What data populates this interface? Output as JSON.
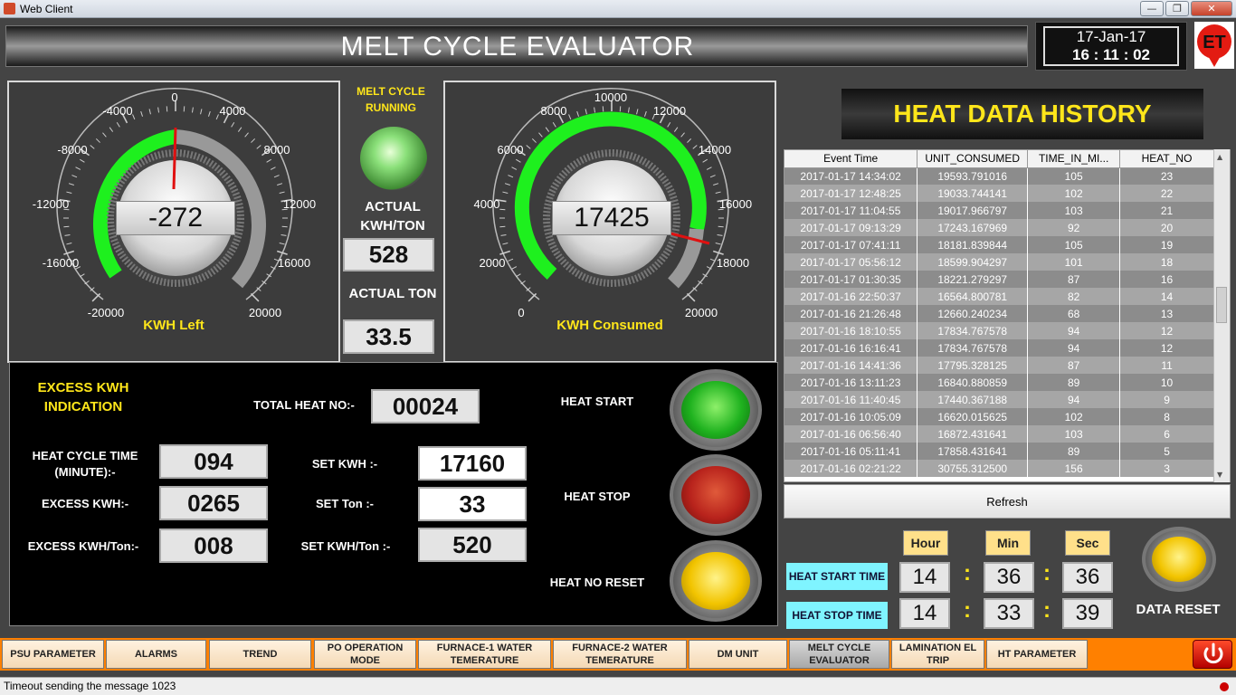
{
  "window": {
    "title": "Web Client",
    "min": "—",
    "max": "❐",
    "close": "✕"
  },
  "header": {
    "title": "MELT CYCLE EVALUATOR",
    "date": "17-Jan-17",
    "time": "16 : 11 : 02",
    "logo_text": "ET"
  },
  "gauge_left": {
    "label": "KWH Left",
    "value": "-272",
    "ticks": [
      "-20000",
      "-16000",
      "-12000",
      "-8000",
      "-4000",
      "0",
      "4000",
      "8000",
      "12000",
      "16000",
      "20000"
    ]
  },
  "gauge_right": {
    "label": "KWH Consumed",
    "value": "17425",
    "ticks": [
      "0",
      "2000",
      "4000",
      "6000",
      "8000",
      "10000",
      "12000",
      "14000",
      "16000",
      "18000",
      "20000"
    ]
  },
  "status": {
    "running_label": "MELT CYCLE RUNNING",
    "actual_kwh_ton_label": "ACTUAL KWH/TON",
    "actual_kwh_ton": "528",
    "actual_ton_label": "ACTUAL TON",
    "actual_ton": "33.5"
  },
  "lower": {
    "excess_indication": "EXCESS KWH INDICATION",
    "total_heat_label": "TOTAL HEAT NO:-",
    "total_heat": "00024",
    "heat_cycle_label": "HEAT CYCLE TIME (MINUTE):-",
    "heat_cycle": "094",
    "excess_kwh_label": "EXCESS KWH:-",
    "excess_kwh": "0265",
    "excess_kwh_ton_label": "EXCESS KWH/Ton:-",
    "excess_kwh_ton": "008",
    "set_kwh_label": "SET KWH :-",
    "set_kwh": "17160",
    "set_ton_label": "SET Ton :-",
    "set_ton": "33",
    "set_kwh_ton_label": "SET KWH/Ton :-",
    "set_kwh_ton": "520",
    "heat_start": "HEAT START",
    "heat_stop": "HEAT STOP",
    "heat_no_reset": "HEAT NO RESET",
    "colors": {
      "start": "#1fb21f",
      "stop": "#b8231c",
      "reset": "#f2c400"
    }
  },
  "history": {
    "title": "HEAT DATA HISTORY",
    "columns": [
      "Event Time",
      "UNIT_CONSUMED",
      "TIME_IN_MI...",
      "HEAT_NO"
    ],
    "rows": [
      [
        "2017-01-17 14:34:02",
        "19593.791016",
        "105",
        "23"
      ],
      [
        "2017-01-17 12:48:25",
        "19033.744141",
        "102",
        "22"
      ],
      [
        "2017-01-17 11:04:55",
        "19017.966797",
        "103",
        "21"
      ],
      [
        "2017-01-17 09:13:29",
        "17243.167969",
        "92",
        "20"
      ],
      [
        "2017-01-17 07:41:11",
        "18181.839844",
        "105",
        "19"
      ],
      [
        "2017-01-17 05:56:12",
        "18599.904297",
        "101",
        "18"
      ],
      [
        "2017-01-17 01:30:35",
        "18221.279297",
        "87",
        "16"
      ],
      [
        "2017-01-16 22:50:37",
        "16564.800781",
        "82",
        "14"
      ],
      [
        "2017-01-16 21:26:48",
        "12660.240234",
        "68",
        "13"
      ],
      [
        "2017-01-16 18:10:55",
        "17834.767578",
        "94",
        "12"
      ],
      [
        "2017-01-16 16:16:41",
        "17834.767578",
        "94",
        "12"
      ],
      [
        "2017-01-16 14:41:36",
        "17795.328125",
        "87",
        "11"
      ],
      [
        "2017-01-16 13:11:23",
        "16840.880859",
        "89",
        "10"
      ],
      [
        "2017-01-16 11:40:45",
        "17440.367188",
        "94",
        "9"
      ],
      [
        "2017-01-16 10:05:09",
        "16620.015625",
        "102",
        "8"
      ],
      [
        "2017-01-16 06:56:40",
        "16872.431641",
        "103",
        "6"
      ],
      [
        "2017-01-16 05:11:41",
        "17858.431641",
        "89",
        "5"
      ],
      [
        "2017-01-16 02:21:22",
        "30755.312500",
        "156",
        "3"
      ]
    ],
    "refresh": "Refresh"
  },
  "times": {
    "hour_label": "Hour",
    "min_label": "Min",
    "sec_label": "Sec",
    "start_label": "HEAT START TIME",
    "stop_label": "HEAT STOP TIME",
    "start": [
      "14",
      "36",
      "36"
    ],
    "stop": [
      "14",
      "33",
      "39"
    ],
    "colon": ":",
    "data_reset": "DATA RESET"
  },
  "nav": [
    "PSU PARAMETER",
    "ALARMS",
    "TREND",
    "PO OPERATION MODE",
    "FURNACE-1 WATER TEMERATURE",
    "FURNACE-2 WATER TEMERATURE",
    "DM UNIT",
    "MELT CYCLE EVALUATOR",
    "LAMINATION EL TRIP",
    "HT PARAMETER"
  ],
  "statusbar": "Timeout sending the message 1023"
}
